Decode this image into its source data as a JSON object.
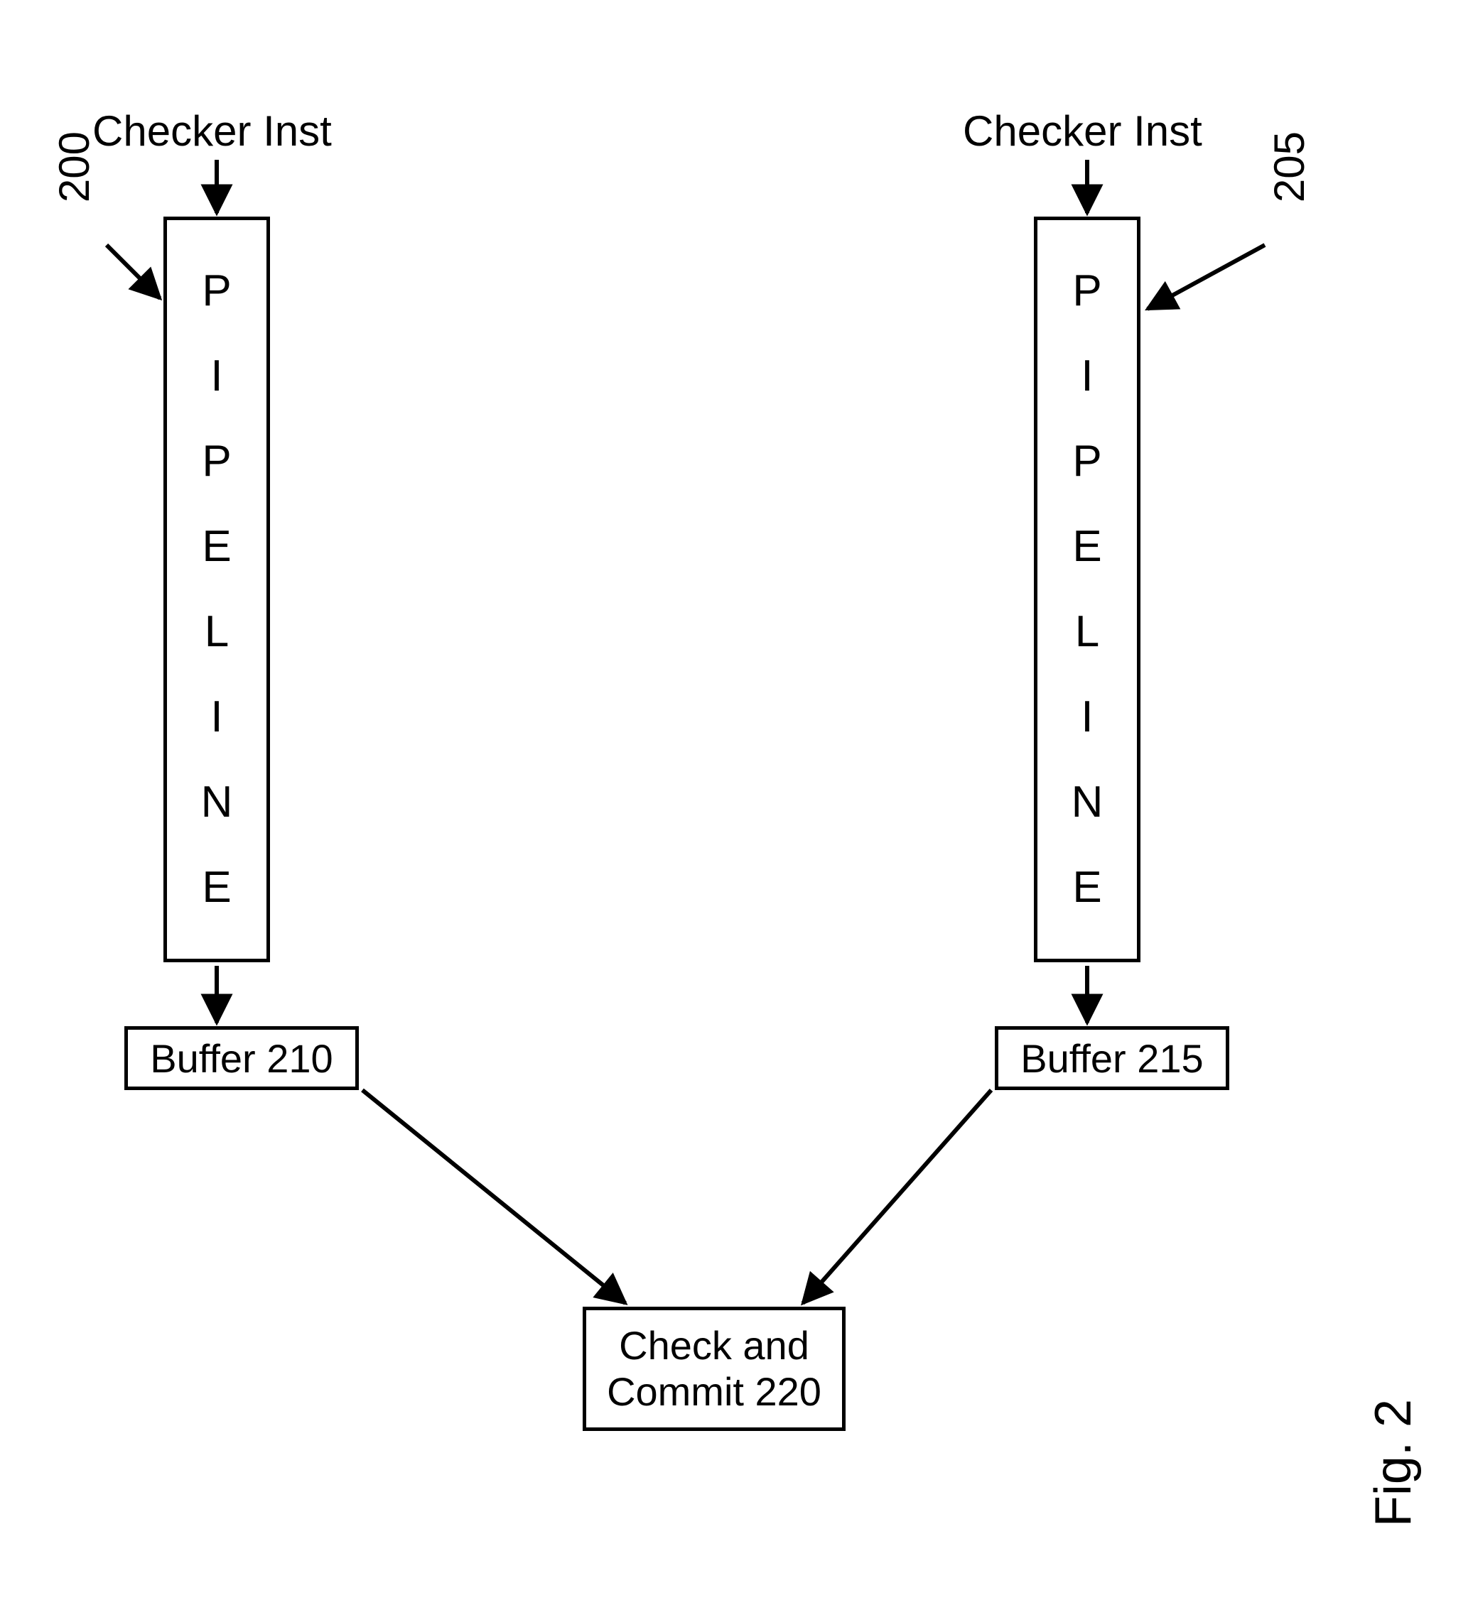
{
  "leftPipeline": {
    "inputLabel": "Checker Inst",
    "refLabel": "200",
    "stages": [
      "P",
      "I",
      "P",
      "E",
      "L",
      "I",
      "N",
      "E"
    ],
    "buffer": "Buffer 210"
  },
  "rightPipeline": {
    "inputLabel": "Checker Inst",
    "refLabel": "205",
    "stages": [
      "P",
      "I",
      "P",
      "E",
      "L",
      "I",
      "N",
      "E"
    ],
    "buffer": "Buffer 215"
  },
  "commit": {
    "line1": "Check and",
    "line2": "Commit 220"
  },
  "figure": "Fig. 2"
}
